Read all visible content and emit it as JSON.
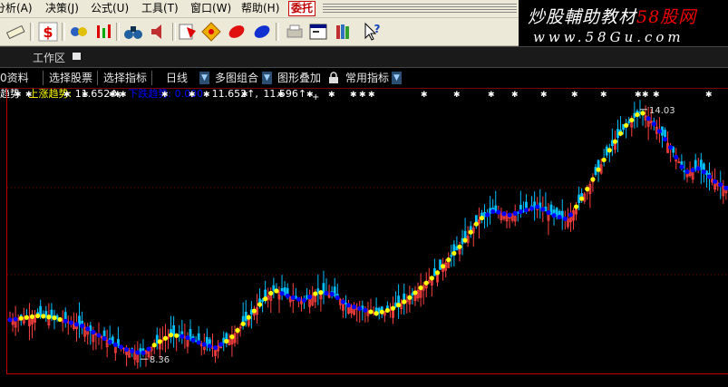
{
  "menu": {
    "items": [
      {
        "label": "分析(A)"
      },
      {
        "label": "决策(J)"
      },
      {
        "label": "公式(U)"
      },
      {
        "label": "工具(T)"
      },
      {
        "label": "窗口(W)"
      },
      {
        "label": "帮助(H)"
      },
      {
        "label": "委托"
      }
    ]
  },
  "toolbar": {
    "icons": [
      "ruler-icon",
      "dollar-icon",
      "sync-icon",
      "bars-icon",
      "binoculars-icon",
      "speaker-icon",
      "stock-icon",
      "diamond-icon",
      "red-ellipse-icon",
      "blue-ellipse-icon",
      "print-icon",
      "window-icon",
      "books-icon",
      "help-icon"
    ]
  },
  "watermark": {
    "line1_prefix": "炒股輔助教材",
    "line1_suffix": "58股网",
    "line2": "www.58Gu.com"
  },
  "workspace": {
    "label": "工作区"
  },
  "func_bar": {
    "items": [
      {
        "label": "0资料"
      },
      {
        "label": "选择股票"
      },
      {
        "label": "选择指标"
      },
      {
        "label": "日线"
      },
      {
        "label": "多图组合"
      },
      {
        "label": "图形叠加"
      },
      {
        "label": "常用指标"
      }
    ]
  },
  "indicator": {
    "name": "趋势",
    "up_label": "上涨趋势:",
    "up_value": "11.652↑,",
    "down_label": "下跌趋势:",
    "down_value": "0.000",
    "v3": "11.652↑,",
    "v4": "11.596↑",
    "colors": {
      "up": "#ffff00",
      "down": "#0000ff",
      "text": "#ffffff"
    }
  },
  "chart_data": {
    "type": "candlestick",
    "annotations": [
      {
        "label": "14.03",
        "kind": "high"
      },
      {
        "label": "8.36",
        "kind": "low"
      }
    ],
    "ylim": [
      8.36,
      14.03
    ],
    "price": [
      9.15,
      9.2,
      9.25,
      9.2,
      9.1,
      9.0,
      8.8,
      8.6,
      8.45,
      8.36,
      8.6,
      8.8,
      8.75,
      8.6,
      8.5,
      8.7,
      9.1,
      9.5,
      9.85,
      9.7,
      9.6,
      9.8,
      9.75,
      9.5,
      9.4,
      9.3,
      9.4,
      9.6,
      9.9,
      10.2,
      10.6,
      11.0,
      11.5,
      11.7,
      11.6,
      11.7,
      11.8,
      11.6,
      11.5,
      12.0,
      12.6,
      13.2,
      13.7,
      14.03,
      13.7,
      13.2,
      12.6,
      12.7,
      12.4,
      12.2
    ],
    "trend_state": [
      "down",
      "up",
      "up",
      "up",
      "down",
      "down",
      "down",
      "down",
      "down",
      "down",
      "up",
      "up",
      "down",
      "down",
      "down",
      "up",
      "up",
      "up",
      "up",
      "down",
      "down",
      "up",
      "down",
      "down",
      "down",
      "up",
      "up",
      "up",
      "up",
      "up",
      "up",
      "up",
      "up",
      "down",
      "down",
      "down",
      "down",
      "down",
      "down",
      "up",
      "up",
      "up",
      "up",
      "up",
      "down",
      "down",
      "down",
      "down",
      "down",
      "down"
    ],
    "colors": {
      "rise": "#ff4040",
      "fall": "#00c0ff",
      "trend_up": "#ffff00",
      "trend_down": "#0000ff",
      "markers": "#ffffff",
      "grid": "#800000",
      "frame": "#c00000"
    }
  }
}
